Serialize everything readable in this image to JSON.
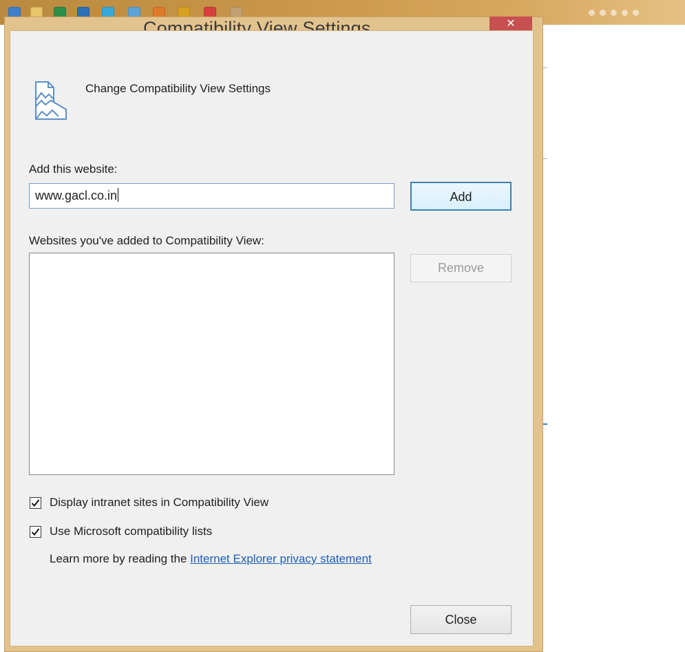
{
  "window": {
    "title": "Compatibility View Settings",
    "close_glyph": "✕"
  },
  "header": {
    "icon": "compatibility-view-icon",
    "text": "Change Compatibility View Settings"
  },
  "add_section": {
    "label": "Add this website:",
    "input_value": "www.gacl.co.in",
    "add_button": "Add"
  },
  "list_section": {
    "label": "Websites you've added to Compatibility View:",
    "items": [],
    "remove_button": "Remove"
  },
  "options": [
    {
      "label": "Display intranet sites in Compatibility View",
      "checked": true
    },
    {
      "label": "Use Microsoft compatibility lists",
      "checked": true
    }
  ],
  "learn_more": {
    "prefix": "Learn more by reading the ",
    "link_text": "Internet Explorer privacy statement"
  },
  "footer": {
    "close_button": "Close"
  },
  "colors": {
    "window_frame": "#e3c38d",
    "close_button": "#c75050",
    "link": "#1a5fb4",
    "default_button_border": "#3c7fb1"
  }
}
